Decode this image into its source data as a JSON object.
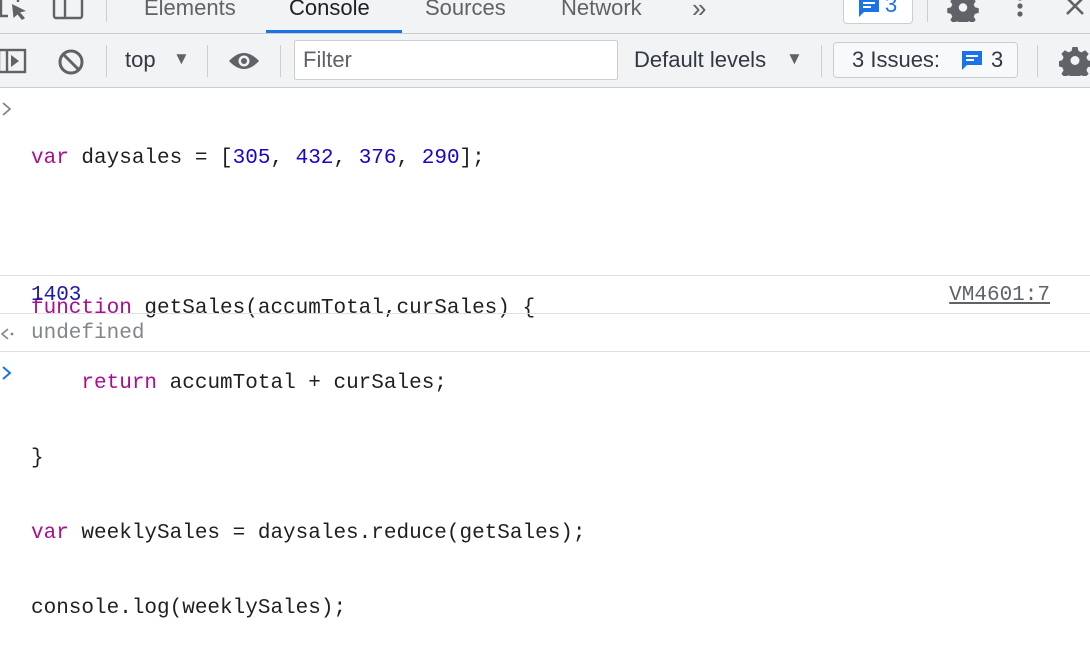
{
  "tabs": {
    "items": [
      {
        "label": "Elements",
        "active": false
      },
      {
        "label": "Console",
        "active": true
      },
      {
        "label": "Sources",
        "active": false
      },
      {
        "label": "Network",
        "active": false
      }
    ],
    "more_label": "»",
    "messages_count": "3"
  },
  "toolbar": {
    "context": "top",
    "context_arrow": "▼",
    "filter_placeholder": "Filter",
    "levels_label": "Default levels",
    "levels_arrow": "▼",
    "issues_label": "3 Issues:",
    "issues_count": "3"
  },
  "console": {
    "input": {
      "line1": {
        "kw": "var",
        "a": " daysales = [",
        "n1": "305",
        "c1": ", ",
        "n2": "432",
        "c2": ", ",
        "n3": "376",
        "c3": ", ",
        "n4": "290",
        "end": "];"
      },
      "line3": {
        "kw": "function",
        "rest": " getSales(accumTotal,curSales) {"
      },
      "line4": {
        "indent": "    ",
        "kw": "return",
        "rest": " accumTotal + curSales;"
      },
      "line5": "}",
      "line6": {
        "kw": "var",
        "rest": " weeklySales = daysales.reduce(getSales);"
      },
      "line7": "console.log(weeklySales);"
    },
    "log_output": "1403",
    "log_source": "VM4601:7",
    "return_value": "undefined"
  },
  "colors": {
    "keyword": "#aa0d91",
    "number": "#1c00cf",
    "accent": "#1a73e8"
  },
  "icons": {
    "inspect": "inspect-element-icon",
    "device": "device-toolbar-icon",
    "messages": "message-icon",
    "settings": "gear-icon",
    "menu": "kebab-menu-icon",
    "close": "close-icon",
    "sidebar": "sidebar-toggle-icon",
    "clear": "clear-console-icon",
    "eye": "eye-icon",
    "issues": "message-icon"
  }
}
